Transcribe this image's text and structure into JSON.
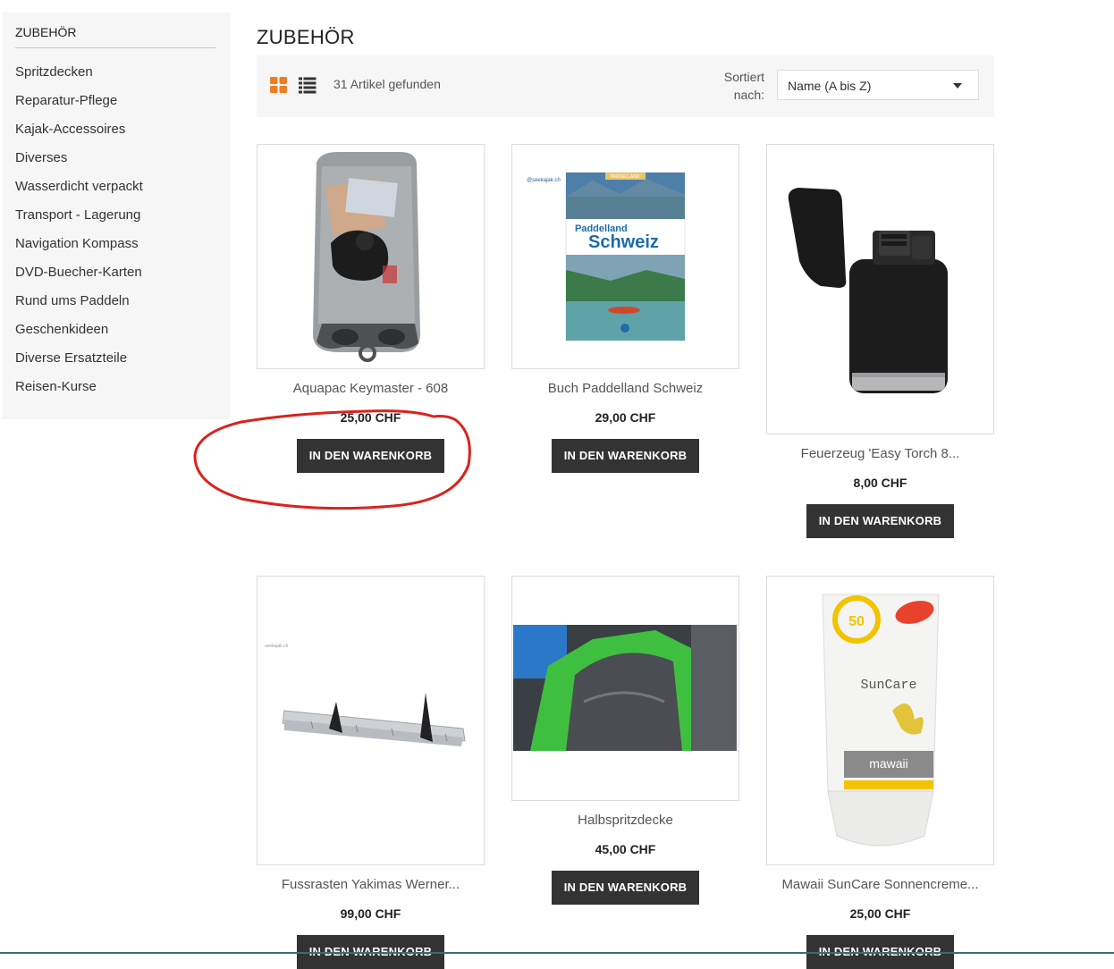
{
  "sidebar": {
    "title": "ZUBEHÖR",
    "items": [
      {
        "label": "Spritzdecken"
      },
      {
        "label": "Reparatur-Pflege"
      },
      {
        "label": "Kajak-Accessoires"
      },
      {
        "label": "Diverses"
      },
      {
        "label": "Wasserdicht verpackt"
      },
      {
        "label": "Transport - Lagerung"
      },
      {
        "label": "Navigation Kompass"
      },
      {
        "label": "DVD-Buecher-Karten"
      },
      {
        "label": "Rund ums Paddeln"
      },
      {
        "label": "Geschenkideen"
      },
      {
        "label": "Diverse Ersatzteile"
      },
      {
        "label": "Reisen-Kurse"
      }
    ]
  },
  "page": {
    "title": "ZUBEHÖR"
  },
  "toolbar": {
    "count": "31 Artikel gefunden",
    "sort_label": "Sortiert nach:",
    "sort_value": "Name (A bis Z)",
    "accent_color": "#f07d21"
  },
  "products": [
    {
      "name": "Aquapac Keymaster - 608",
      "price": "25,00 CHF",
      "button": "IN DEN WARENKORB"
    },
    {
      "name": "Buch Paddelland Schweiz",
      "price": "29,00 CHF",
      "button": "IN DEN WARENKORB",
      "image_text": {
        "brand": "@seekajak.ch",
        "series": "PADDELLAND",
        "title1": "Paddelland",
        "title2": "Schweiz"
      }
    },
    {
      "name": "Feuerzeug 'Easy Torch 8...",
      "price": "8,00 CHF",
      "button": "IN DEN WARENKORB"
    },
    {
      "name": "Fussrasten Yakimas Werner...",
      "price": "99,00 CHF",
      "button": "IN DEN WARENKORB",
      "image_text": {
        "watermark": "seekajak.ch"
      }
    },
    {
      "name": "Halbspritzdecke",
      "price": "45,00 CHF",
      "button": "IN DEN WARENKORB"
    },
    {
      "name": "Mawaii SunCare Sonnencreme...",
      "price": "25,00 CHF",
      "button": "IN DEN WARENKORB",
      "image_text": {
        "spf": "50",
        "brand": "SunCare",
        "maker": "mawaii"
      }
    }
  ]
}
